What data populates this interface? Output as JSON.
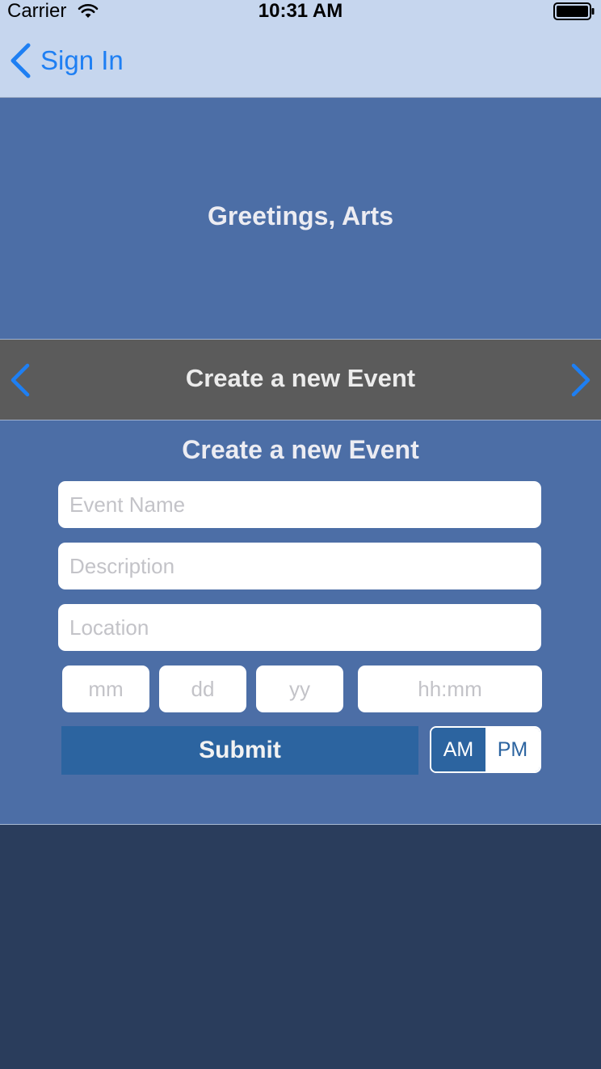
{
  "status_bar": {
    "carrier": "Carrier",
    "time": "10:31 AM",
    "wifi_icon": "wifi-icon",
    "battery_icon": "battery-full-icon"
  },
  "nav": {
    "back_label": "Sign In",
    "back_icon": "chevron-left-icon",
    "accent_color": "#1e7ff3"
  },
  "greeting": "Greetings, Arts",
  "carousel": {
    "title": "Create a new Event",
    "prev_icon": "chevron-left-icon",
    "next_icon": "chevron-right-icon"
  },
  "form": {
    "title": "Create a new Event",
    "event_name": {
      "value": "",
      "placeholder": "Event Name"
    },
    "description": {
      "value": "",
      "placeholder": "Description"
    },
    "location": {
      "value": "",
      "placeholder": "Location"
    },
    "month": {
      "value": "",
      "placeholder": "mm"
    },
    "day": {
      "value": "",
      "placeholder": "dd"
    },
    "year": {
      "value": "",
      "placeholder": "yy"
    },
    "time": {
      "value": "",
      "placeholder": "hh:mm"
    },
    "submit_label": "Submit",
    "ampm": {
      "options": [
        "AM",
        "PM"
      ],
      "selected": "AM"
    }
  },
  "colors": {
    "panel_background": "#4c6ea6",
    "carousel_background": "#5b5b5b",
    "page_background": "#2a3d5c",
    "submit_background": "#2c64a0",
    "nav_background": "#c6d6ee"
  }
}
